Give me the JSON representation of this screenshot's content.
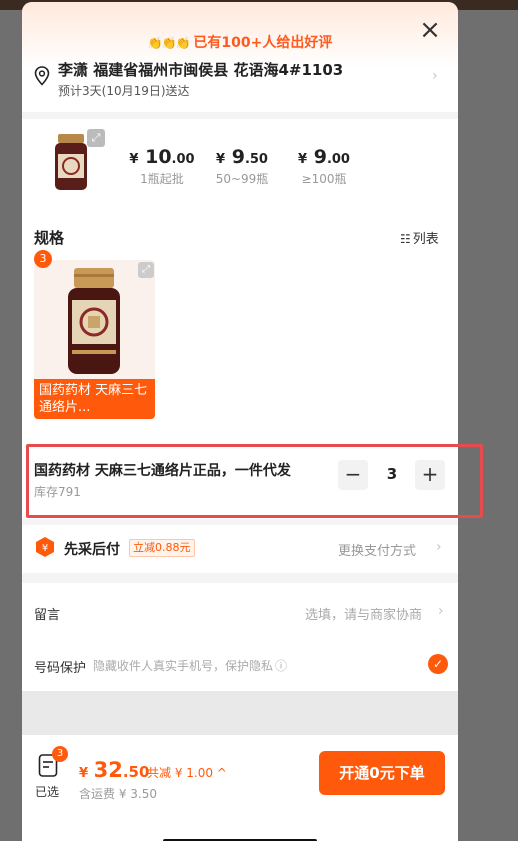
{
  "banner": {
    "icons": "👏👏👏",
    "text": "已有100+人给出好评"
  },
  "close_glyph": "×",
  "address": {
    "main": "李潇 福建省福州市闽侯县 花语海4#1103",
    "delivery": "预计3天(10月19日)送达"
  },
  "price_tiers": [
    {
      "yen": "¥",
      "int": "10",
      "dec": ".00",
      "note": "1瓶起批"
    },
    {
      "yen": "¥",
      "int": "9",
      "dec": ".50",
      "note": "50~99瓶"
    },
    {
      "yen": "¥",
      "int": "9",
      "dec": ".00",
      "note": "≥100瓶"
    }
  ],
  "spec": {
    "title": "规格",
    "list_label": "列表",
    "product_label": "国药药材 天麻三七通络片...",
    "badge_count": "3"
  },
  "sku": {
    "name": "国药药材 天麻三七通络片正品，一件代发",
    "stock": "库存791",
    "quantity": "3",
    "minus": "−",
    "plus": "+"
  },
  "payment": {
    "title": "先采后付",
    "tag": "立减0.88元",
    "switch_label": "更换支付方式"
  },
  "message": {
    "label": "留言",
    "hint": "选填，请与商家协商"
  },
  "privacy": {
    "label": "号码保护",
    "hint": "隐藏收件人真实手机号，保护隐私"
  },
  "footer": {
    "cart_badge": "3",
    "cart_label": "已选",
    "total_yen": "¥",
    "total_int": "32",
    "total_dec": ".50",
    "discount": "共减 ¥ 1.00 ^",
    "shipping": "含运费 ¥ 3.50",
    "order_button": "开通0元下单"
  },
  "colors": {
    "accent": "#ff5a0c",
    "highlight": "#e74c4c"
  }
}
